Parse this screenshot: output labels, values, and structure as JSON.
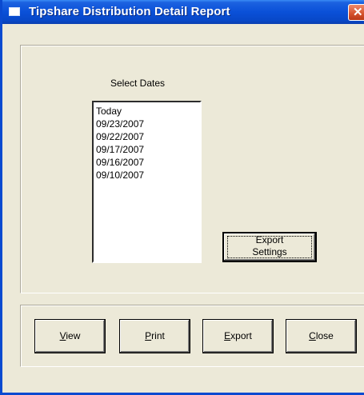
{
  "window": {
    "title": "Tipshare Distribution Detail Report",
    "close_glyph": "✕"
  },
  "dates": {
    "label": "Select Dates",
    "items": [
      "Today",
      "09/23/2007",
      "09/22/2007",
      "09/17/2007",
      "09/16/2007",
      "09/10/2007"
    ]
  },
  "export_settings": {
    "line1": "Export",
    "line2": "Settings"
  },
  "buttons": {
    "view": {
      "accel": "V",
      "rest": "iew"
    },
    "print": {
      "accel": "P",
      "rest": "rint"
    },
    "export": {
      "accel": "E",
      "rest": "xport"
    },
    "close": {
      "accel": "C",
      "rest": "lose"
    }
  },
  "colors": {
    "titlebar": "#0a50d8",
    "face": "#ece9d8",
    "close_button": "#d4502c"
  },
  "icons": {
    "title": "window-app-icon",
    "close": "close-icon"
  }
}
